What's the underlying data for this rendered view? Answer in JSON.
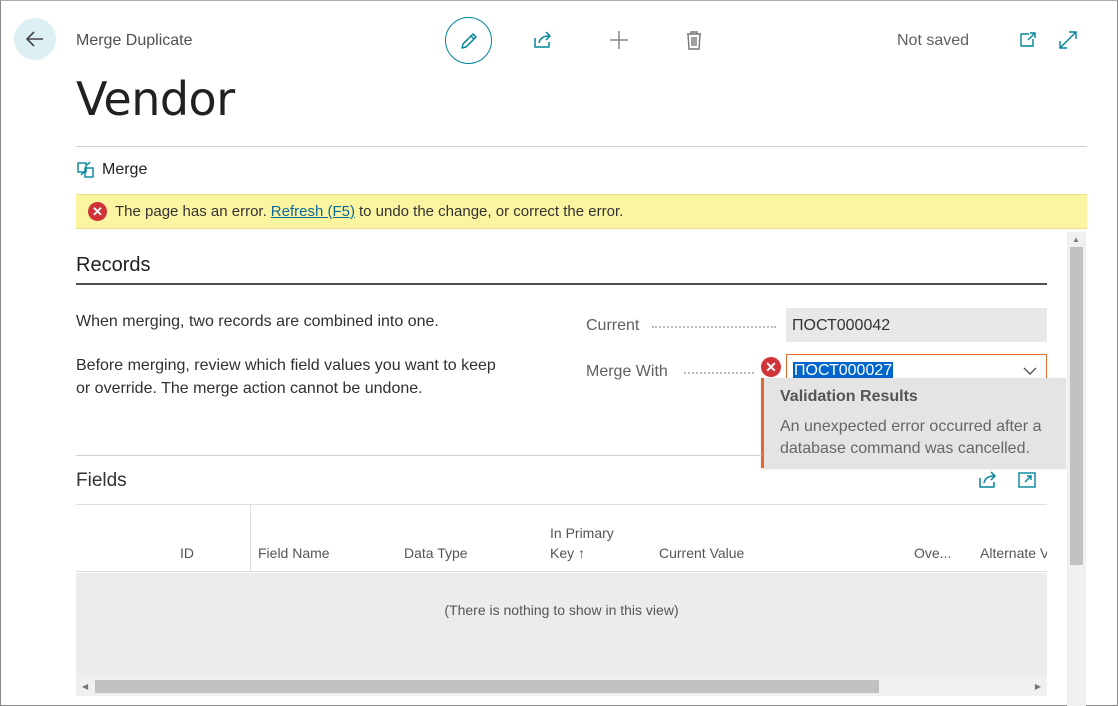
{
  "header": {
    "caption": "Merge Duplicate",
    "title": "Vendor",
    "status": "Not saved"
  },
  "actions": {
    "merge_label": "Merge"
  },
  "error_bar": {
    "prefix": "The page has an error.",
    "link": "Refresh (F5)",
    "suffix": "to undo the change, or correct the error."
  },
  "records": {
    "title": "Records",
    "desc1": "When merging, two records are combined into one.",
    "desc2_line1": "Before merging, review which field values you want to keep",
    "desc2_line2": "or override. The merge action cannot be undone.",
    "current_label": "Current",
    "current_value": "ПОСТ000042",
    "merge_with_label": "Merge With",
    "merge_with_value": "ПОСТ000027"
  },
  "tooltip": {
    "title": "Validation Results",
    "body_line1": "An unexpected error occurred after a",
    "body_line2": "database command was cancelled."
  },
  "fields": {
    "title": "Fields",
    "columns": [
      "ID",
      "Field Name",
      "Data Type",
      "In Primary",
      "Key ↑",
      "Current Value",
      "Ove...",
      "Alternate V"
    ],
    "empty_message": "(There is nothing to show in this view)"
  },
  "colors": {
    "accent": "#00849a",
    "error": "#d13438",
    "warning_bg": "#fbf5a1",
    "field_error_border": "#e36a2b"
  }
}
